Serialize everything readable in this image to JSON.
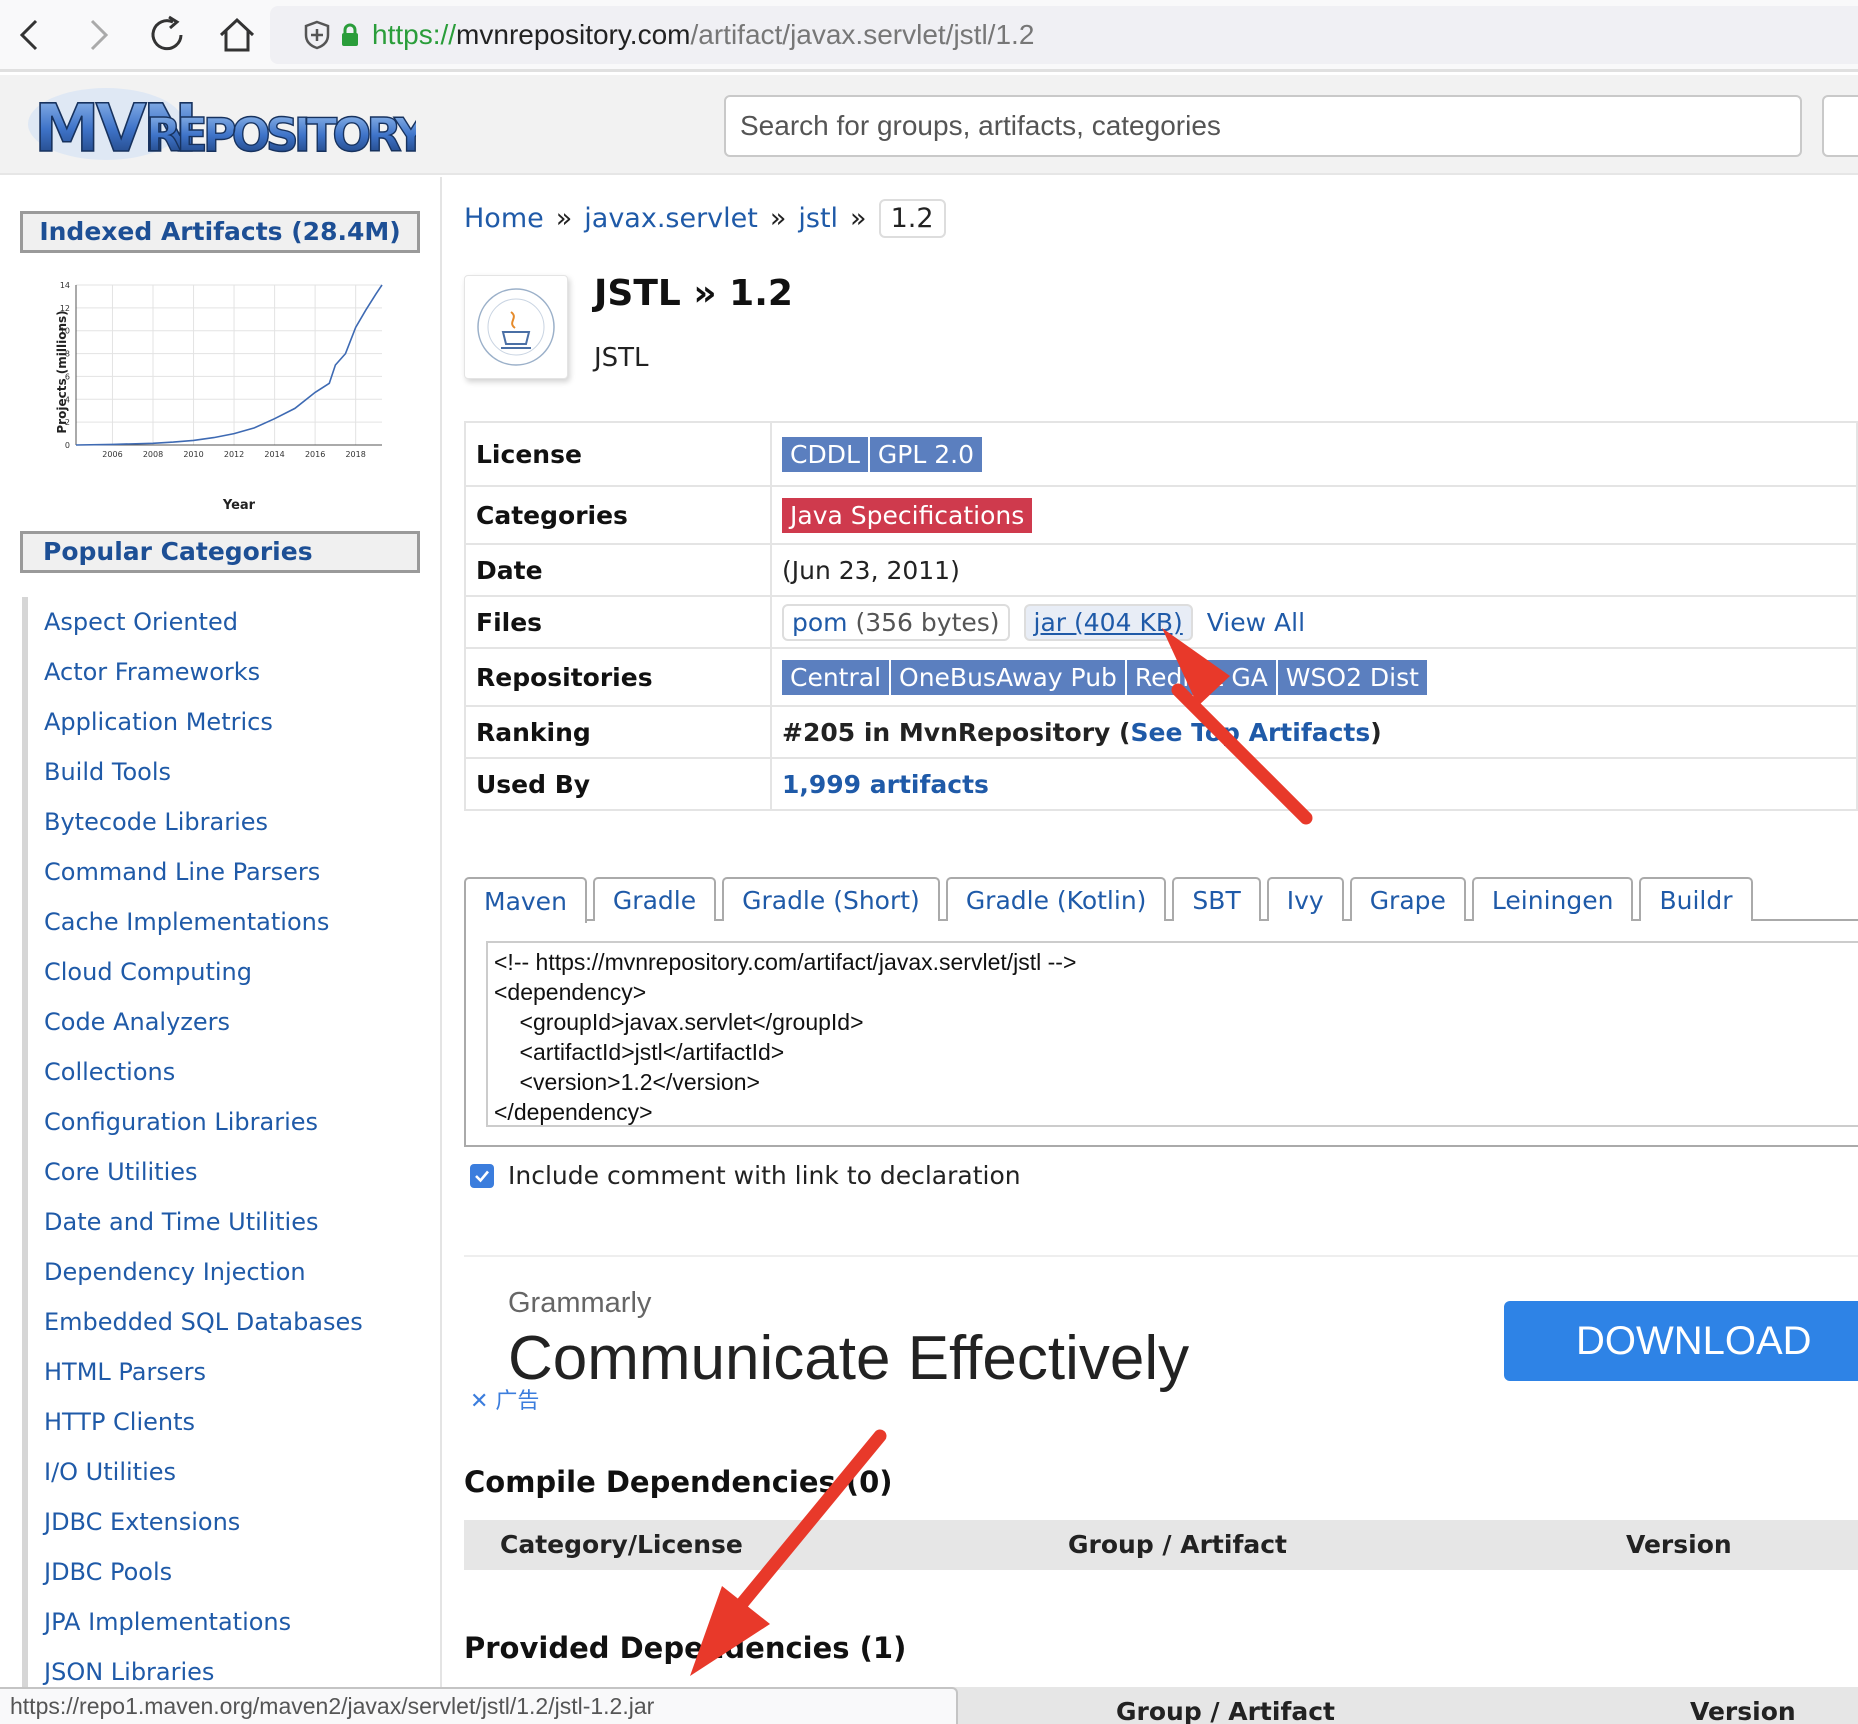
{
  "browser": {
    "url_scheme": "https://",
    "url_host": "mvnrepository.com",
    "url_path": "/artifact/javax.servlet/jstl/1.2"
  },
  "site": {
    "search_placeholder": "Search for groups, artifacts, categories"
  },
  "sidebar": {
    "indexed_title": "Indexed Artifacts (28.4M)",
    "growth_chart_title": "Projects (millions)",
    "growth_chart_xlabel": "Year",
    "popular_title": "Popular Categories",
    "categories": [
      "Aspect Oriented",
      "Actor Frameworks",
      "Application Metrics",
      "Build Tools",
      "Bytecode Libraries",
      "Command Line Parsers",
      "Cache Implementations",
      "Cloud Computing",
      "Code Analyzers",
      "Collections",
      "Configuration Libraries",
      "Core Utilities",
      "Date and Time Utilities",
      "Dependency Injection",
      "Embedded SQL Databases",
      "HTML Parsers",
      "HTTP Clients",
      "I/O Utilities",
      "JDBC Extensions",
      "JDBC Pools",
      "JPA Implementations",
      "JSON Libraries"
    ]
  },
  "chart_data": {
    "type": "line",
    "title": "",
    "xlabel": "Year",
    "ylabel": "Projects (millions)",
    "x_ticks": [
      "2006",
      "2008",
      "2010",
      "2012",
      "2014",
      "2016",
      "2018"
    ],
    "y_ticks": [
      "0",
      "2",
      "4",
      "6",
      "8",
      "10",
      "12",
      "14"
    ],
    "xlim": [
      2004.2,
      2019.3
    ],
    "ylim": [
      0,
      14
    ],
    "grid": true,
    "series": [
      {
        "x": [
          2004.2,
          2006,
          2008,
          2009,
          2010,
          2011,
          2012,
          2013,
          2014,
          2015,
          2016,
          2016.7,
          2017,
          2017.5,
          2018,
          2018.5,
          2019,
          2019.3
        ],
        "y": [
          0.0,
          0.05,
          0.15,
          0.25,
          0.4,
          0.65,
          1.0,
          1.5,
          2.3,
          3.2,
          4.6,
          5.4,
          7.0,
          8.0,
          10.3,
          11.8,
          13.2,
          14.0
        ]
      }
    ]
  },
  "breadcrumb": {
    "home": "Home",
    "group": "javax.servlet",
    "artifact": "jstl",
    "version": "1.2",
    "sep": "»"
  },
  "artifact": {
    "title": "JSTL » 1.2",
    "subtitle": "JSTL"
  },
  "info": {
    "license_label": "License",
    "licenses": [
      "CDDL",
      "GPL 2.0"
    ],
    "categories_label": "Categories",
    "category": "Java Specifications",
    "date_label": "Date",
    "date": "(Jun 23, 2011)",
    "files_label": "Files",
    "pom_name": "pom",
    "pom_size": "(356 bytes)",
    "jar_text": "jar (404 KB)",
    "view_all": "View All",
    "repositories_label": "Repositories",
    "repositories": [
      "Central",
      "OneBusAway Pub",
      "Redhat GA",
      "WSO2 Dist"
    ],
    "ranking_label": "Ranking",
    "ranking_text": "#205 in MvnRepository (",
    "ranking_link": "See Top Artifacts",
    "ranking_close": ")",
    "used_by_label": "Used By",
    "used_by": "1,999 artifacts"
  },
  "tabs": [
    "Maven",
    "Gradle",
    "Gradle (Short)",
    "Gradle (Kotlin)",
    "SBT",
    "Ivy",
    "Grape",
    "Leiningen",
    "Buildr"
  ],
  "snippet": "<!-- https://mvnrepository.com/artifact/javax.servlet/jstl -->\n<dependency>\n    <groupId>javax.servlet</groupId>\n    <artifactId>jstl</artifactId>\n    <version>1.2</version>\n</dependency>",
  "include_comment": "Include comment with link to declaration",
  "ad": {
    "brand": "Grammarly",
    "headline": "Communicate Effectively",
    "button": "DOWNLOAD",
    "close": "✕ 广告"
  },
  "compile_deps": {
    "title": "Compile Dependencies (0)",
    "col_category": "Category/License",
    "col_artifact": "Group / Artifact",
    "col_version": "Version"
  },
  "provided_deps": {
    "title": "Provided Dependencies (1)",
    "col_artifact": "Group / Artifact",
    "col_version": "Version"
  },
  "status_url": "https://repo1.maven.org/maven2/javax/servlet/jstl/1.2/jstl-1.2.jar",
  "colors": {
    "link": "#1f5aa8",
    "tag_blue": "#5b7fbf",
    "tag_red": "#cf3a4d",
    "ad_button": "#2e83e6",
    "annotation_arrow": "#e8392a"
  },
  "icons": [
    "back-icon",
    "forward-icon",
    "reload-icon",
    "home-icon",
    "shield-icon",
    "lock-icon",
    "checkbox-checked-icon",
    "close-icon"
  ]
}
